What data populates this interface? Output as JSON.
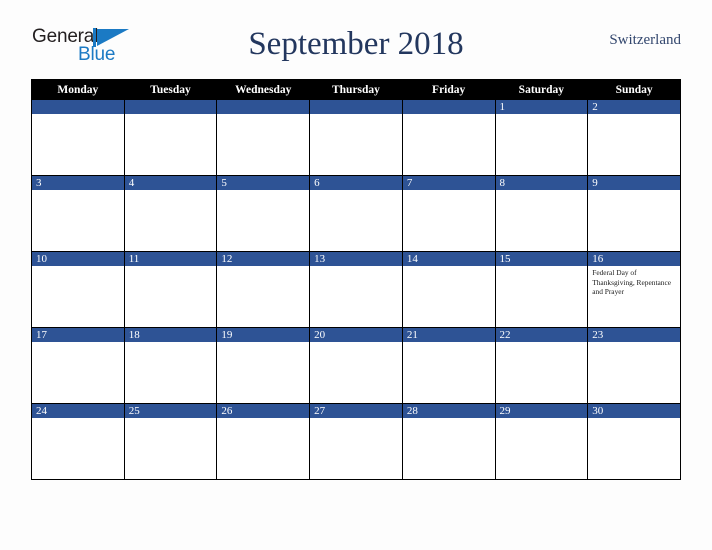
{
  "brand": {
    "name_part1": "General",
    "name_part2": "Blue",
    "mark": "triangle-pennant",
    "color_dark": "#231f20",
    "color_blue": "#1b7ac4"
  },
  "header": {
    "title": "September 2018",
    "country": "Switzerland",
    "title_color": "#23375e"
  },
  "calendar": {
    "accent_color": "#2e5395",
    "header_bg": "#000000",
    "weekday_headers": [
      "Monday",
      "Tuesday",
      "Wednesday",
      "Thursday",
      "Friday",
      "Saturday",
      "Sunday"
    ],
    "weeks": [
      [
        {
          "date": "",
          "event": ""
        },
        {
          "date": "",
          "event": ""
        },
        {
          "date": "",
          "event": ""
        },
        {
          "date": "",
          "event": ""
        },
        {
          "date": "",
          "event": ""
        },
        {
          "date": "1",
          "event": ""
        },
        {
          "date": "2",
          "event": ""
        }
      ],
      [
        {
          "date": "3",
          "event": ""
        },
        {
          "date": "4",
          "event": ""
        },
        {
          "date": "5",
          "event": ""
        },
        {
          "date": "6",
          "event": ""
        },
        {
          "date": "7",
          "event": ""
        },
        {
          "date": "8",
          "event": ""
        },
        {
          "date": "9",
          "event": ""
        }
      ],
      [
        {
          "date": "10",
          "event": ""
        },
        {
          "date": "11",
          "event": ""
        },
        {
          "date": "12",
          "event": ""
        },
        {
          "date": "13",
          "event": ""
        },
        {
          "date": "14",
          "event": ""
        },
        {
          "date": "15",
          "event": ""
        },
        {
          "date": "16",
          "event": "Federal Day of Thanksgiving, Repentance and Prayer"
        }
      ],
      [
        {
          "date": "17",
          "event": ""
        },
        {
          "date": "18",
          "event": ""
        },
        {
          "date": "19",
          "event": ""
        },
        {
          "date": "20",
          "event": ""
        },
        {
          "date": "21",
          "event": ""
        },
        {
          "date": "22",
          "event": ""
        },
        {
          "date": "23",
          "event": ""
        }
      ],
      [
        {
          "date": "24",
          "event": ""
        },
        {
          "date": "25",
          "event": ""
        },
        {
          "date": "26",
          "event": ""
        },
        {
          "date": "27",
          "event": ""
        },
        {
          "date": "28",
          "event": ""
        },
        {
          "date": "29",
          "event": ""
        },
        {
          "date": "30",
          "event": ""
        }
      ]
    ]
  }
}
